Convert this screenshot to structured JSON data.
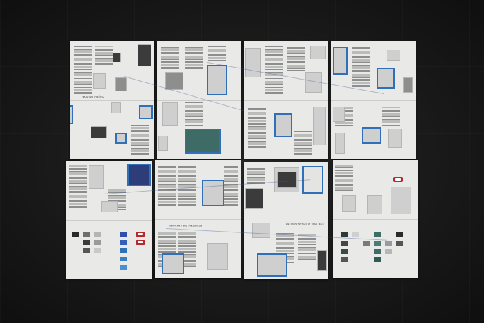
{
  "scene": {
    "description_type": "photograph",
    "colors": {
      "floor": "#161616",
      "paper": "#e9e9e7",
      "accent_frame": "#2f70b8",
      "red_badge": "#b42b2b",
      "teal_block": "#3f6b66"
    }
  },
  "sheets": [
    {
      "heading_top": "",
      "heading_bottom": ""
    },
    {
      "heading_top": "",
      "heading_bottom": ""
    },
    {
      "heading_top": "",
      "heading_bottom": ""
    },
    {
      "heading_top": "",
      "heading_bottom": ""
    },
    {
      "heading_top": "",
      "heading_bottom": ""
    },
    {
      "heading_top": "",
      "heading_bottom": "",
      "heading_bottom_text": "REWRITING THE UNKNOWN"
    },
    {
      "heading_top": "",
      "heading_bottom": "",
      "heading_bottom_text": "THE TRUE ARTIFICIAL SYSTEMS"
    },
    {
      "heading_top": "",
      "heading_bottom": ""
    }
  ]
}
